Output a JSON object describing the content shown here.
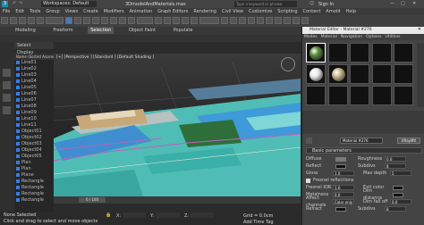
{
  "titlebar": {
    "workspace_label": "Workspaces: Default",
    "file_title": "3DmodelAndMaterials.max",
    "search_placeholder": "Type a keyword or phrase",
    "signin_label": "Sign In"
  },
  "menubar": {
    "items": [
      "File",
      "Edit",
      "Tools",
      "Group",
      "Views",
      "Create",
      "Modifiers",
      "Animation",
      "Graph Editors",
      "Rendering",
      "Civil View",
      "Customize",
      "Scripting",
      "Content",
      "Arnold",
      "Help"
    ]
  },
  "ribbon": {
    "tabs": [
      "Modeling",
      "Freeform",
      "Selection",
      "Object Paint",
      "Populate"
    ]
  },
  "scene": {
    "tabs": [
      "Select",
      "Display"
    ],
    "header": "Name (Sorted Ascending)",
    "items": [
      "Line01",
      "Line02",
      "Line03",
      "Line04",
      "Line05",
      "Line06",
      "Line07",
      "Line08",
      "Line09",
      "Line10",
      "Line11",
      "Object01",
      "Object02",
      "Object03",
      "Object04",
      "Object05",
      "Plan",
      "Plan",
      "Plane",
      "Rectangle",
      "Rectangle",
      "Rectangle",
      "Rectangle"
    ]
  },
  "viewport": {
    "label": "[+] [Perspective ] [Standard ] [Default Shading ]"
  },
  "timeline": {
    "frame": "0 / 100"
  },
  "status": {
    "selection": "None Selected",
    "prompt": "Click and drag to select and move objects",
    "grid": "Grid = 0.0cm",
    "add_time_tag": "Add Time Tag",
    "x_label": "X:",
    "y_label": "Y:",
    "z_label": "Z:"
  },
  "material_editor": {
    "title": "Material Editor - Material #276",
    "menu": [
      "Modes",
      "Material",
      "Navigation",
      "Options",
      "Utilities"
    ],
    "material_name": "Material #276",
    "type_label": "VRayMtl",
    "rollout": "Basic parameters",
    "rows": [
      {
        "label": "Diffuse",
        "value": "",
        "label2": "Roughness",
        "value2": "0.0"
      },
      {
        "label": "Reflect",
        "value": "",
        "label2": "Subdivs",
        "value2": "8"
      },
      {
        "label": "Gloss",
        "value": "1.0",
        "label2": "Max depth",
        "value2": "5"
      },
      {
        "label": "Fresnel IOR",
        "value": "1.6",
        "label2": "Exit color",
        "value2": ""
      },
      {
        "label": "Metalness",
        "value": "0.0",
        "label2": "Dim distance",
        "value2": ""
      },
      {
        "label": "Affect channels",
        "value": "Color only",
        "label2": "Dim fall off",
        "value2": "0.0"
      },
      {
        "label": "Refract",
        "value": "",
        "label2": "Subdivs",
        "value2": "8"
      }
    ],
    "fresnel_label": "Fresnel reflections",
    "colors": {
      "sphere_green": "#5a8a3a",
      "sphere_white": "#e8e8e8",
      "sphere_beige": "#c8b48a"
    }
  }
}
